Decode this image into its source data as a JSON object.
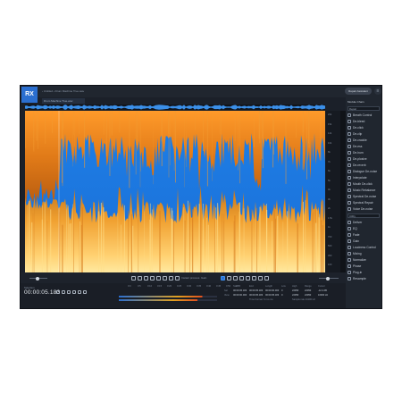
{
  "app": {
    "logo": "RX",
    "breadcrumb": "›  Untitled  ›  Drum Machine True.wav",
    "file_tab": "Drum Machine True.wav",
    "repair_button": "Repair Assistant",
    "menu_icon": "hamburger-icon"
  },
  "right_panel": {
    "module_chain": "Module Chain",
    "filter_repair": "Repair",
    "filter_utility": "Utility",
    "repair_modules": [
      "Breath Control",
      "De-bleed",
      "De-click",
      "De-clip",
      "De-crackle",
      "De-ess",
      "De-hum",
      "De-plosive",
      "De-reverb",
      "Dialogue De-noise",
      "Interpolate",
      "Mouth De-click",
      "Music Rebalance",
      "Spectral De-noise",
      "Spectral Repair",
      "Voice De-noise"
    ],
    "utility_modules": [
      "Deliver",
      "EQ",
      "Fade",
      "Gain",
      "Loudness Control",
      "Mixing",
      "Normalize",
      "Phase",
      "Plug-in",
      "Resample"
    ]
  },
  "toolbar": {
    "instant_process": "Instant process",
    "mode": "Gain"
  },
  "transport": {
    "format_label": "Selection",
    "timecode": "00:00:05.183",
    "timeline_ticks": [
      "0:0",
      "0:5",
      "0:10",
      "0:15",
      "0:20",
      "0:25",
      "0:30",
      "0:35",
      "0:40",
      "0:45",
      "0:50",
      "0:55"
    ],
    "table_headers": [
      "Start",
      "End",
      "Length",
      "Low",
      "High",
      "Range",
      "Cursor"
    ],
    "sel_label": "Sel",
    "view_label": "View",
    "sel_values": [
      "00:00:05.183",
      "00:00:05.183",
      "00:00:00.000",
      "0",
      "22050",
      "22050",
      "-12.2 dB"
    ],
    "view_values": [
      "00:00:00.000",
      "00:00:05.183",
      "00:00:05.183",
      "0",
      "22050",
      "22050",
      "16000 Hz"
    ],
    "extra_label": "Time Format:",
    "extra_value": "h:m:s.ms",
    "sample_label": "Sample rate",
    "sample_value": "44100 Hz"
  },
  "freq_scale": [
    "20k",
    "15k",
    "12k",
    "10k",
    "8k",
    "7k",
    "6k",
    "5k",
    "4k",
    "3k",
    "2k",
    "1.5k",
    "1k",
    "700",
    "500",
    "300",
    "100"
  ]
}
